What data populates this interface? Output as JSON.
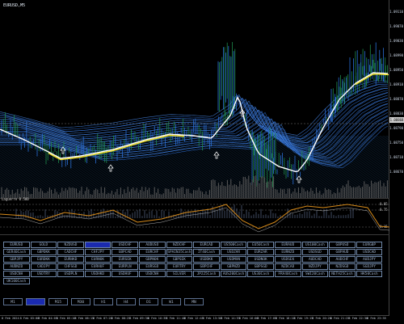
{
  "window": {
    "title": "EURUSD,M5"
  },
  "price_axis": {
    "labels": [
      "1.09110",
      "1.09070",
      "1.09030",
      "1.08990",
      "1.08950",
      "1.08910",
      "1.08870",
      "1.08830",
      "1.08790",
      "1.08750",
      "1.08710",
      "1.08670"
    ],
    "current_price": "1.08868"
  },
  "indicator": {
    "title": "Laguerre 0.500",
    "levels": [
      "0.85",
      "0.75",
      "0.15"
    ]
  },
  "pairs": [
    "EURUSD",
    "GOLD",
    "NZDUSD",
    "GBPJPY",
    "USDCHF",
    "AUDUSD",
    "NZDCHF",
    "EURCAD",
    "US500Cash",
    "EU50Cash",
    "EURAUD",
    "US100Cash",
    "GBPUSD",
    "EURGBP",
    "GER40Cash",
    "GBPDKK",
    "CADCHF",
    "CHFJPY",
    "GBPCAD",
    "EURCHF",
    "SPAIN35Cash",
    "IT40Cash",
    "USDZAR",
    "EURZAR",
    "EURNZD",
    "USDSGD",
    "GBPAUD",
    "USDCAD",
    "GBPJPY",
    "EURDKK",
    "EURHKD",
    "EURNOK",
    "EURSEK",
    "GBPNOK",
    "GBPSEK",
    "USDDKK",
    "USDMXN",
    "USDNOK",
    "USDSEK",
    "AUDCAD",
    "AUDCHF",
    "AUDJPY",
    "AUDNZD",
    "CADJPY",
    "CHFSGD",
    "EURHUF",
    "EURPLN",
    "EURSGD",
    "EURTRY",
    "GBPCHF",
    "GBPNZD",
    "GBPSGD",
    "NZDCAD",
    "NZDJPY",
    "NZDSGD",
    "SGDJPY",
    "USDCNH",
    "USDTRY",
    "USDPLN",
    "USDHKD",
    "USDHUF",
    "USDCNH",
    "SILVER",
    "JP225Cash",
    "AUS200Cash",
    "US30Cash",
    "FRA40Cash",
    "SWI20Cash",
    "NETH25Cash",
    "HK50Cash",
    "UK100Cash"
  ],
  "selected_pair": "GBPJPY",
  "timeframes": [
    "M1",
    "M5",
    "M15",
    "M30",
    "H1",
    "H4",
    "D1",
    "W1",
    "MN"
  ],
  "selected_timeframe": "M5",
  "time_axis": [
    "8 Feb 2024",
    "8 Feb 03:00",
    "8 Feb 04:05",
    "8 Feb 05:10",
    "8 Feb 06:15",
    "8 Feb 07:20",
    "8 Feb 08:25",
    "8 Feb 09:30",
    "8 Feb 10:35",
    "8 Feb 11:40",
    "8 Feb 12:45",
    "8 Feb 13:50",
    "8 Feb 14:55",
    "8 Feb 16:00",
    "8 Feb 17:05",
    "8 Feb 18:10",
    "8 Feb 19:15",
    "8 Feb 20:20",
    "8 Feb 21:25",
    "8 Feb 22:30",
    "8 Feb 23:35"
  ]
}
